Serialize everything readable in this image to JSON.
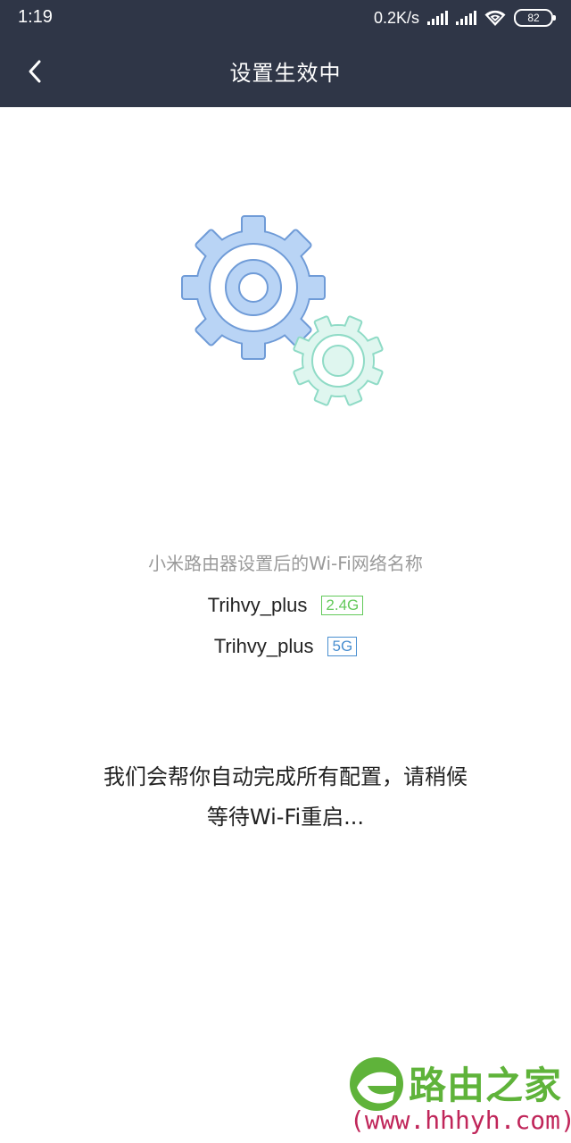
{
  "status_bar": {
    "time": "1:19",
    "network_speed": "0.2K/s",
    "battery_level": "82",
    "icons": [
      "signal-icon",
      "signal-icon",
      "wifi-icon",
      "battery-icon"
    ]
  },
  "nav": {
    "title": "设置生效中",
    "back_icon": "chevron-left-icon"
  },
  "illustration": {
    "icons": [
      "large-gear-icon",
      "small-gear-icon"
    ],
    "colors": {
      "large_gear_fill": "#b9d4f5",
      "large_gear_stroke": "#6f9bd7",
      "small_gear_fill": "#dff6ef",
      "small_gear_stroke": "#8fdbc6"
    }
  },
  "wifi": {
    "heading": "小米路由器设置后的Wi-Fi网络名称",
    "networks": [
      {
        "ssid": "Trihvy_plus",
        "band": "2.4G",
        "color": "#63c95a"
      },
      {
        "ssid": "Trihvy_plus",
        "band": "5G",
        "color": "#4a8fd0"
      }
    ]
  },
  "message": {
    "line1": "我们会帮你自动完成所有配置，请稍候",
    "line2": "等待Wi-Fi重启..."
  },
  "watermark": {
    "logo_icon": "router-home-logo-icon",
    "brand": "路由之家",
    "url": "(www.hhhyh.com)"
  },
  "colors": {
    "header_background": "#2f3647",
    "page_background": "#ffffff"
  }
}
